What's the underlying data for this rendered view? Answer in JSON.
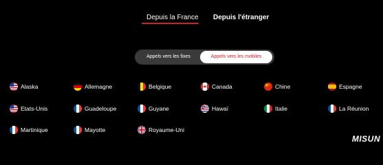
{
  "tabs": {
    "active_label": "Depuis la France",
    "inactive_label": "Depuis l'étranger"
  },
  "toggle": {
    "fixes_label": "Appels vers les fixes",
    "mobiles_label": "Appels vers les mobiles",
    "selected": "mobiles"
  },
  "accent_color": "#d21f2b",
  "destinations": [
    {
      "label": "Alaska",
      "flag": "us-flag-icon"
    },
    {
      "label": "Allemagne",
      "flag": "germany-flag-icon"
    },
    {
      "label": "Belgique",
      "flag": "belgium-flag-icon"
    },
    {
      "label": "Canada",
      "flag": "canada-flag-icon"
    },
    {
      "label": "Chine",
      "flag": "china-flag-icon"
    },
    {
      "label": "Espagne",
      "flag": "spain-flag-icon"
    },
    {
      "label": "Etats-Unis",
      "flag": "us-flag-icon"
    },
    {
      "label": "Guadeloupe",
      "flag": "france-flag-icon"
    },
    {
      "label": "Guyane",
      "flag": "france-flag-icon"
    },
    {
      "label": "Hawaï",
      "flag": "hawaii-flag-icon"
    },
    {
      "label": "Italie",
      "flag": "italy-flag-icon"
    },
    {
      "label": "La Réunion",
      "flag": "france-flag-icon"
    },
    {
      "label": "Martinique",
      "flag": "france-flag-icon"
    },
    {
      "label": "Mayotte",
      "flag": "france-flag-icon"
    },
    {
      "label": "Royaume-Uni",
      "flag": "uk-flag-icon"
    }
  ],
  "watermark": "MISUN"
}
